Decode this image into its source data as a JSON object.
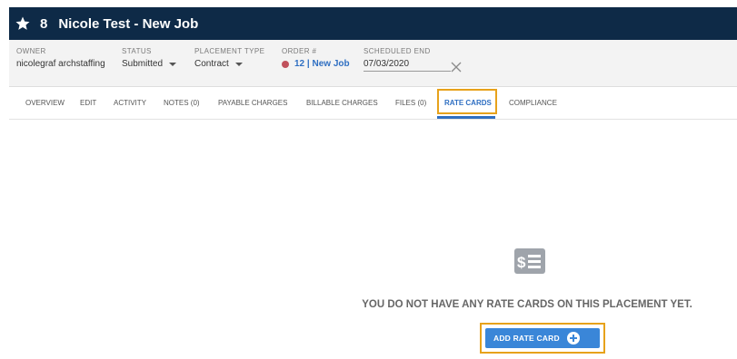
{
  "header": {
    "job_id": "8",
    "title": "Nicole Test - New Job",
    "favorite_icon": "star-icon"
  },
  "info": {
    "owner": {
      "label": "OWNER",
      "value": "nicolegraf archstaffing"
    },
    "status": {
      "label": "STATUS",
      "value": "Submitted"
    },
    "placement_type": {
      "label": "PLACEMENT TYPE",
      "value": "Contract"
    },
    "order": {
      "label": "ORDER #",
      "value": "12 | New Job",
      "dot_color": "#c0515c"
    },
    "scheduled_end": {
      "label": "SCHEDULED END",
      "value": "07/03/2020"
    }
  },
  "tabs": [
    {
      "label": "OVERVIEW"
    },
    {
      "label": "EDIT"
    },
    {
      "label": "ACTIVITY"
    },
    {
      "label": "NOTES (0)"
    },
    {
      "label": "PAYABLE CHARGES"
    },
    {
      "label": "BILLABLE CHARGES"
    },
    {
      "label": "FILES (0)"
    },
    {
      "label": "RATE CARDS",
      "active": true
    },
    {
      "label": "COMPLIANCE"
    }
  ],
  "empty_state": {
    "icon": "rate-card-icon",
    "message": "YOU DO NOT HAVE ANY RATE CARDS ON THIS PLACEMENT YET.",
    "button_label": "ADD RATE CARD"
  },
  "colors": {
    "header_bg": "#0e2a47",
    "accent": "#2f6fc2",
    "button": "#3a86d8",
    "highlight": "#e7a21b"
  }
}
